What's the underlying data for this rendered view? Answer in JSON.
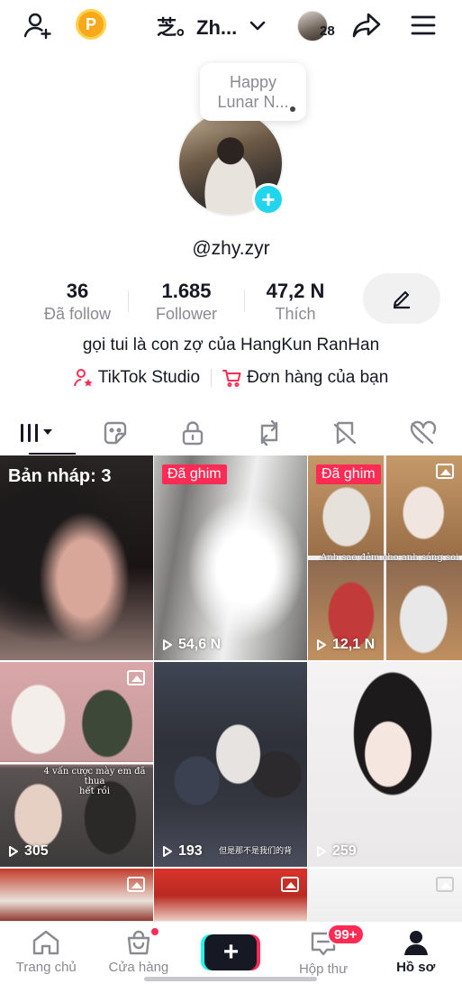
{
  "topbar": {
    "add_friend_icon": "add-user-icon",
    "coin_label": "P",
    "title": "芝。Zh...",
    "story_count": "28"
  },
  "profile": {
    "bubble_note": "Happy Lunar N...",
    "username": "@zhy.zyr",
    "stats": [
      {
        "value": "36",
        "label": "Đã follow"
      },
      {
        "value": "1.685",
        "label": "Follower"
      },
      {
        "value": "47,2 N",
        "label": "Thích"
      }
    ],
    "bio": "gọi tui là con zợ của HangKun RanHan",
    "links": [
      {
        "label": "TikTok Studio"
      },
      {
        "label": "Đơn hàng của bạn"
      }
    ]
  },
  "tabs": [
    {
      "icon": "grid-icon",
      "active": true
    },
    {
      "icon": "sticker-icon",
      "active": false
    },
    {
      "icon": "lock-icon",
      "active": false
    },
    {
      "icon": "repost-icon",
      "active": false
    },
    {
      "icon": "bookmark-icon",
      "active": false
    },
    {
      "icon": "liked-icon",
      "active": false
    }
  ],
  "grid": {
    "draft_label": "Bản nháp: 3",
    "pinned_label": "Đã ghim",
    "views": [
      "54,6 N",
      "12,1 N",
      "305",
      "193",
      "259"
    ],
    "captions": {
      "c3": "Anh sao đêm cho anh sáng soi",
      "c4_line1": "4 vấn cược mày em đã thua",
      "c4_line2": "hết rồi",
      "c5": "但是那不是我们的背"
    }
  },
  "bottomnav": {
    "items": [
      {
        "label": "Trang chủ"
      },
      {
        "label": "Cửa hàng"
      },
      {
        "label": ""
      },
      {
        "label": "Hộp thư"
      },
      {
        "label": "Hồ sơ"
      }
    ],
    "inbox_badge": "99+"
  },
  "colors": {
    "accent": "#fe2c55",
    "teal": "#20d5ec",
    "muted": "#8a8b91"
  }
}
